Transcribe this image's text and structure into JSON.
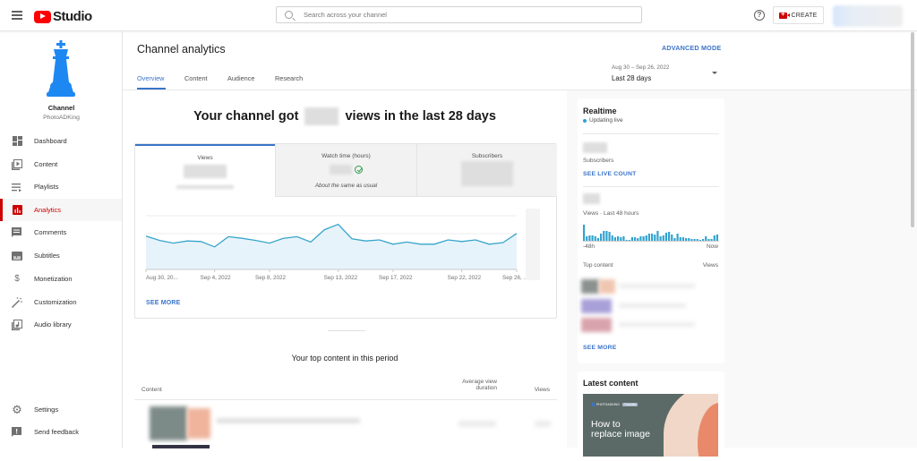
{
  "topbar": {
    "app_name": "Studio",
    "search_placeholder": "Search across your channel",
    "create_label": "CREATE"
  },
  "sidebar": {
    "channel_label": "Channel",
    "channel_name": "PhotoADKing",
    "items": [
      {
        "label": "Dashboard",
        "icon": "dashboard-icon"
      },
      {
        "label": "Content",
        "icon": "content-icon"
      },
      {
        "label": "Playlists",
        "icon": "playlists-icon"
      },
      {
        "label": "Analytics",
        "icon": "analytics-icon",
        "active": true
      },
      {
        "label": "Comments",
        "icon": "comments-icon"
      },
      {
        "label": "Subtitles",
        "icon": "subtitles-icon"
      },
      {
        "label": "Monetization",
        "icon": "dollar-icon"
      },
      {
        "label": "Customization",
        "icon": "magic-wand-icon"
      },
      {
        "label": "Audio library",
        "icon": "audio-library-icon"
      }
    ],
    "bottom_items": [
      {
        "label": "Settings",
        "icon": "gear-icon"
      },
      {
        "label": "Send feedback",
        "icon": "feedback-icon"
      }
    ]
  },
  "header": {
    "title": "Channel analytics",
    "advanced_mode": "ADVANCED MODE",
    "tabs": [
      {
        "label": "Overview",
        "active": true
      },
      {
        "label": "Content"
      },
      {
        "label": "Audience"
      },
      {
        "label": "Research"
      }
    ],
    "date_range_sub": "Aug 30 – Sep 26, 2022",
    "date_range_main": "Last 28 days"
  },
  "overview": {
    "hero_prefix": "Your channel got",
    "hero_suffix": "views in the last 28 days",
    "metrics": [
      {
        "label": "Views",
        "active": true
      },
      {
        "label": "Watch time (hours)",
        "note": "About the same as usual"
      },
      {
        "label": "Subscribers"
      }
    ],
    "see_more": "SEE MORE",
    "top_content_title": "Your top content in this period",
    "table_headers": {
      "content": "Content",
      "avg_line1": "Average view",
      "avg_line2": "duration",
      "views": "Views"
    }
  },
  "chart_data": {
    "type": "area",
    "title": "Views",
    "series": [
      {
        "name": "Views",
        "values": [
          0.62,
          0.54,
          0.49,
          0.53,
          0.52,
          0.42,
          0.61,
          0.58,
          0.54,
          0.49,
          0.58,
          0.61,
          0.51,
          0.74,
          0.84,
          0.57,
          0.53,
          0.55,
          0.47,
          0.51,
          0.47,
          0.47,
          0.55,
          0.52,
          0.55,
          0.47,
          0.5,
          0.67
        ]
      }
    ],
    "x_tick_labels": [
      "Aug 30, 20...",
      "Sep 4, 2022",
      "Sep 8, 2022",
      "Sep 13, 2022",
      "Sep 17, 2022",
      "Sep 22, 2022",
      "Sep 26, ..."
    ],
    "x_tick_indices": [
      0,
      5,
      9,
      14,
      18,
      23,
      27
    ],
    "y_values_note": "relative (y-axis labels obscured)",
    "ylim": [
      0,
      1
    ],
    "grid": true
  },
  "realtime": {
    "title": "Realtime",
    "status": "Updating live",
    "subscribers_label": "Subscribers",
    "see_live_count": "SEE LIVE COUNT",
    "views_label": "Views · Last 48 hours",
    "axis_start": "-48h",
    "axis_end": "Now",
    "bars": [
      0.9,
      0.25,
      0.3,
      0.3,
      0.25,
      0.15,
      0.4,
      0.55,
      0.55,
      0.5,
      0.3,
      0.2,
      0.25,
      0.2,
      0.25,
      0.05,
      0.05,
      0.2,
      0.2,
      0.15,
      0.25,
      0.25,
      0.3,
      0.4,
      0.4,
      0.35,
      0.55,
      0.25,
      0.3,
      0.45,
      0.5,
      0.35,
      0.15,
      0.4,
      0.2,
      0.2,
      0.15,
      0.15,
      0.1,
      0.1,
      0.1,
      0.05,
      0.1,
      0.25,
      0.1,
      0.1,
      0.3,
      0.35
    ],
    "top_content_label": "Top content",
    "views_col": "Views",
    "see_more": "SEE MORE"
  },
  "latest": {
    "title": "Latest content",
    "thumb_brand": "PHOTOADKING",
    "thumb_badge": "Tutorials",
    "thumb_line1": "How to",
    "thumb_line2": "replace image"
  }
}
